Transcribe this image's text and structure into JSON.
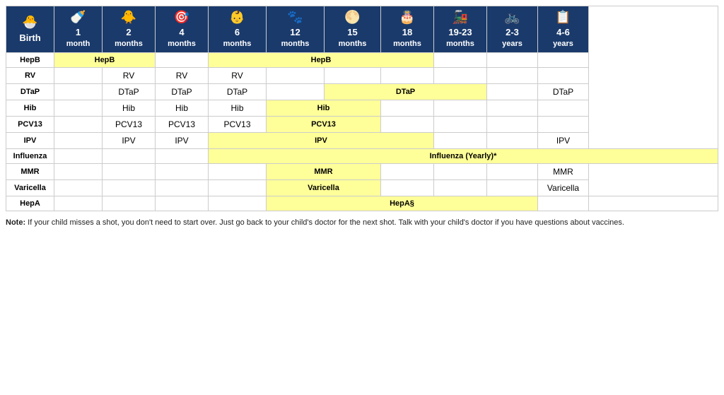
{
  "header": {
    "columns": [
      {
        "id": "birth",
        "icon": "🐣",
        "line1": "Birth",
        "line2": ""
      },
      {
        "id": "1m",
        "icon": "🍼",
        "line1": "1",
        "line2": "month"
      },
      {
        "id": "2m",
        "icon": "🐥",
        "line1": "2",
        "line2": "months"
      },
      {
        "id": "4m",
        "icon": "🎯",
        "line1": "4",
        "line2": "months"
      },
      {
        "id": "6m",
        "icon": "👶",
        "line1": "6",
        "line2": "months"
      },
      {
        "id": "12m",
        "icon": "🐾",
        "line1": "12",
        "line2": "months"
      },
      {
        "id": "15m",
        "icon": "🌕",
        "line1": "15",
        "line2": "months"
      },
      {
        "id": "18m",
        "icon": "🎂",
        "line1": "18",
        "line2": "months"
      },
      {
        "id": "1923m",
        "icon": "🚂",
        "line1": "19-23",
        "line2": "months"
      },
      {
        "id": "23y",
        "icon": "🚲",
        "line1": "2-3",
        "line2": "years"
      },
      {
        "id": "46y",
        "icon": "📋",
        "line1": "4-6",
        "line2": "years"
      }
    ]
  },
  "rows": [
    {
      "name": "HepB",
      "cells": [
        {
          "col": "birth",
          "type": "name"
        },
        {
          "col": "1m",
          "type": "yellow",
          "text": "HepB",
          "colspan": 2
        },
        {
          "col": "4m",
          "type": "empty"
        },
        {
          "col": "6m",
          "type": "yellow",
          "text": "HepB",
          "colspan": 4
        },
        {
          "col": "1923m",
          "type": "empty"
        },
        {
          "col": "23y",
          "type": "empty"
        },
        {
          "col": "46y",
          "type": "empty"
        }
      ]
    },
    {
      "name": "RV",
      "cells": [
        {
          "col": "birth",
          "type": "name"
        },
        {
          "col": "1m",
          "type": "empty"
        },
        {
          "col": "2m",
          "type": "text",
          "text": "RV"
        },
        {
          "col": "4m",
          "type": "text",
          "text": "RV"
        },
        {
          "col": "6m",
          "type": "text",
          "text": "RV"
        },
        {
          "col": "12m",
          "type": "empty"
        },
        {
          "col": "15m",
          "type": "empty"
        },
        {
          "col": "18m",
          "type": "empty"
        },
        {
          "col": "1923m",
          "type": "empty"
        },
        {
          "col": "23y",
          "type": "empty"
        },
        {
          "col": "46y",
          "type": "empty"
        }
      ]
    },
    {
      "name": "DTaP",
      "cells": [
        {
          "col": "birth",
          "type": "name"
        },
        {
          "col": "1m",
          "type": "empty"
        },
        {
          "col": "2m",
          "type": "text",
          "text": "DTaP"
        },
        {
          "col": "4m",
          "type": "text",
          "text": "DTaP"
        },
        {
          "col": "6m",
          "type": "text",
          "text": "DTaP"
        },
        {
          "col": "12m",
          "type": "empty"
        },
        {
          "col": "15m",
          "type": "yellow",
          "text": "DTaP",
          "colspan": 3
        },
        {
          "col": "1923m",
          "type": "hidden"
        },
        {
          "col": "23y",
          "type": "hidden"
        },
        {
          "col": "23y",
          "type": "empty"
        },
        {
          "col": "46y",
          "type": "text",
          "text": "DTaP"
        }
      ]
    },
    {
      "name": "Hib",
      "cells": [
        {
          "col": "birth",
          "type": "name"
        },
        {
          "col": "1m",
          "type": "empty"
        },
        {
          "col": "2m",
          "type": "text",
          "text": "Hib"
        },
        {
          "col": "4m",
          "type": "text",
          "text": "Hib"
        },
        {
          "col": "6m",
          "type": "text",
          "text": "Hib"
        },
        {
          "col": "12m",
          "type": "yellow",
          "text": "Hib",
          "colspan": 2
        },
        {
          "col": "15m",
          "type": "hidden"
        },
        {
          "col": "18m",
          "type": "empty"
        },
        {
          "col": "1923m",
          "type": "empty"
        },
        {
          "col": "23y",
          "type": "empty"
        },
        {
          "col": "46y",
          "type": "empty"
        }
      ]
    },
    {
      "name": "PCV13",
      "cells": [
        {
          "col": "birth",
          "type": "name"
        },
        {
          "col": "1m",
          "type": "empty"
        },
        {
          "col": "2m",
          "type": "text",
          "text": "PCV13"
        },
        {
          "col": "4m",
          "type": "text",
          "text": "PCV13"
        },
        {
          "col": "6m",
          "type": "text",
          "text": "PCV13"
        },
        {
          "col": "12m",
          "type": "yellow",
          "text": "PCV13",
          "colspan": 2
        },
        {
          "col": "15m",
          "type": "hidden"
        },
        {
          "col": "18m",
          "type": "empty"
        },
        {
          "col": "1923m",
          "type": "empty"
        },
        {
          "col": "23y",
          "type": "empty"
        },
        {
          "col": "46y",
          "type": "empty"
        }
      ]
    },
    {
      "name": "IPV",
      "cells": [
        {
          "col": "birth",
          "type": "name"
        },
        {
          "col": "1m",
          "type": "empty"
        },
        {
          "col": "2m",
          "type": "text",
          "text": "IPV"
        },
        {
          "col": "4m",
          "type": "text",
          "text": "IPV"
        },
        {
          "col": "6m",
          "type": "yellow",
          "text": "IPV",
          "colspan": 4
        },
        {
          "col": "12m",
          "type": "hidden"
        },
        {
          "col": "15m",
          "type": "hidden"
        },
        {
          "col": "18m",
          "type": "hidden"
        },
        {
          "col": "1923m",
          "type": "empty"
        },
        {
          "col": "23y",
          "type": "empty"
        },
        {
          "col": "46y",
          "type": "text",
          "text": "IPV"
        }
      ]
    },
    {
      "name": "Influenza",
      "cells": [
        {
          "col": "birth",
          "type": "name"
        },
        {
          "col": "1m",
          "type": "empty"
        },
        {
          "col": "2m",
          "type": "empty"
        },
        {
          "col": "4m",
          "type": "empty"
        },
        {
          "col": "6m",
          "type": "yellow",
          "text": "Influenza (Yearly)*",
          "colspan": 8
        }
      ]
    },
    {
      "name": "MMR",
      "cells": [
        {
          "col": "birth",
          "type": "name"
        },
        {
          "col": "1m",
          "type": "empty"
        },
        {
          "col": "2m",
          "type": "empty"
        },
        {
          "col": "4m",
          "type": "empty"
        },
        {
          "col": "6m",
          "type": "empty"
        },
        {
          "col": "12m",
          "type": "yellow",
          "text": "MMR",
          "colspan": 2
        },
        {
          "col": "15m",
          "type": "hidden"
        },
        {
          "col": "18m",
          "type": "empty"
        },
        {
          "col": "1923m",
          "type": "empty"
        },
        {
          "col": "23y",
          "type": "empty"
        },
        {
          "col": "46y",
          "type": "text",
          "text": "MMR"
        }
      ]
    },
    {
      "name": "Varicella",
      "cells": [
        {
          "col": "birth",
          "type": "name"
        },
        {
          "col": "1m",
          "type": "empty"
        },
        {
          "col": "2m",
          "type": "empty"
        },
        {
          "col": "4m",
          "type": "empty"
        },
        {
          "col": "6m",
          "type": "empty"
        },
        {
          "col": "12m",
          "type": "yellow",
          "text": "Varicella",
          "colspan": 2
        },
        {
          "col": "15m",
          "type": "hidden"
        },
        {
          "col": "18m",
          "type": "empty"
        },
        {
          "col": "1923m",
          "type": "empty"
        },
        {
          "col": "23y",
          "type": "empty"
        },
        {
          "col": "46y",
          "type": "text",
          "text": "Varicella"
        }
      ]
    },
    {
      "name": "HepA",
      "cells": [
        {
          "col": "birth",
          "type": "name"
        },
        {
          "col": "1m",
          "type": "empty"
        },
        {
          "col": "2m",
          "type": "empty"
        },
        {
          "col": "4m",
          "type": "empty"
        },
        {
          "col": "6m",
          "type": "empty"
        },
        {
          "col": "12m",
          "type": "yellow",
          "text": "HepA§",
          "colspan": 5
        },
        {
          "col": "15m",
          "type": "hidden"
        },
        {
          "col": "18m",
          "type": "hidden"
        },
        {
          "col": "1923m",
          "type": "hidden"
        },
        {
          "col": "23y",
          "type": "hidden"
        },
        {
          "col": "23y",
          "type": "empty"
        },
        {
          "col": "46y",
          "type": "empty"
        }
      ]
    }
  ],
  "note": "Note: If your child misses a shot, you don't need to start over. Just go back to your child's doctor for the next shot. Talk with your child's doctor if you have questions about vaccines.",
  "note_bold": "Note:",
  "colors": {
    "header_bg": "#1a3a6b",
    "header_text": "#ffffff",
    "yellow": "#ffff99",
    "border": "#cccccc"
  }
}
